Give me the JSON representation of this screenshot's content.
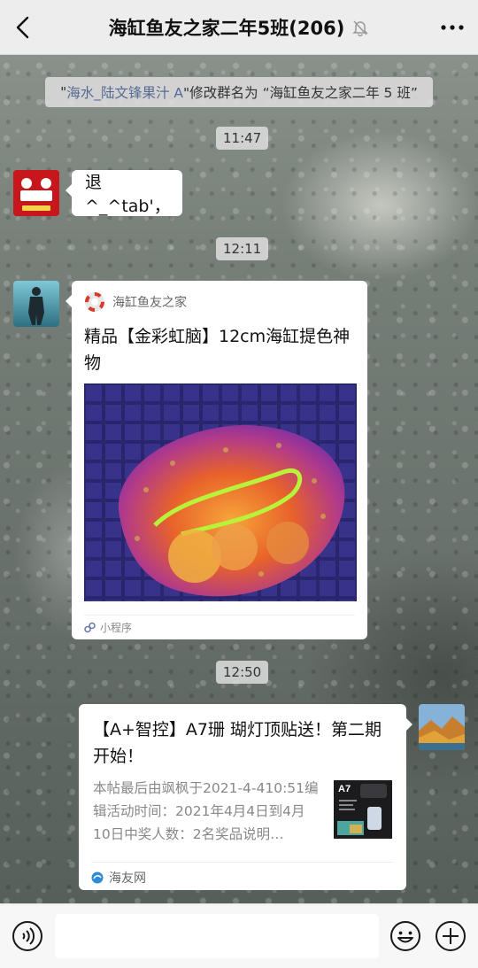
{
  "header": {
    "title": "海缸鱼友之家二年5班(206)",
    "back_icon": "chevron-left-icon",
    "mute_icon": "bell-off-icon",
    "more_icon": "more-dots-icon"
  },
  "system_notice": {
    "quote_open": "\"",
    "actor": "海水_陆文锋果汁 A",
    "text": "\"修改群名为 “海缸鱼友之家二年 5 班”"
  },
  "messages": {
    "time1": "11:47",
    "msg1": {
      "text": "退 ^_^tab'，",
      "avatar_text": "五金人"
    },
    "time2": "12:11",
    "mini_program": {
      "source": "海缸鱼友之家",
      "title": "精品【金彩虹脑】12cm海缸提色神物",
      "footer_label": "小程序",
      "footer_icon": "mini-program-icon"
    },
    "time3": "12:50",
    "link_card": {
      "title": "【A+智控】A7珊 瑚灯顶贴送！第二期开始！",
      "description": "本帖最后由飒枫于2021-4-410:51编辑活动时间：2021年4月4日到4月10日中奖人数：2名奖品说明…",
      "thumb_label": "A7",
      "source": "海友网",
      "source_icon": "site-logo-icon"
    }
  },
  "input_bar": {
    "voice_icon": "voice-icon",
    "emoji_icon": "emoji-icon",
    "plus_icon": "plus-icon",
    "text_value": ""
  }
}
